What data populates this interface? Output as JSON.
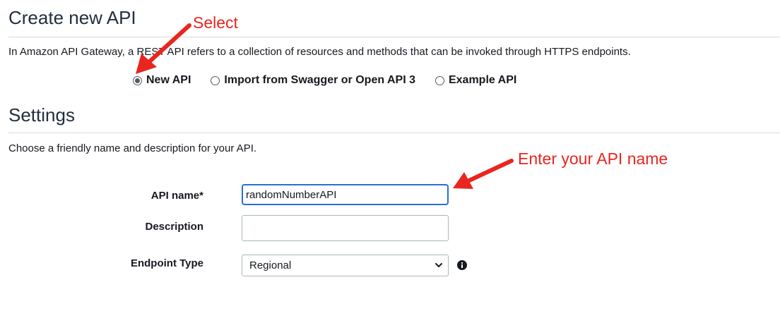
{
  "header": {
    "title": "Create new API",
    "intro": "In Amazon API Gateway, a REST API refers to a collection of resources and methods that can be invoked through HTTPS endpoints."
  },
  "api_type": {
    "options": [
      {
        "label": "New API",
        "selected": true
      },
      {
        "label": "Import from Swagger or Open API 3",
        "selected": false
      },
      {
        "label": "Example API",
        "selected": false
      }
    ]
  },
  "settings": {
    "title": "Settings",
    "description": "Choose a friendly name and description for your API.",
    "api_name_label": "API name*",
    "api_name_value": "randomNumberAPI",
    "description_label": "Description",
    "description_value": "",
    "endpoint_label": "Endpoint Type",
    "endpoint_value": "Regional"
  },
  "annotations": {
    "select": "Select",
    "enter_name": "Enter your API name",
    "color": "#e8261f"
  },
  "icons": {
    "info": "info-icon",
    "chevron": "chevron-down-icon"
  }
}
